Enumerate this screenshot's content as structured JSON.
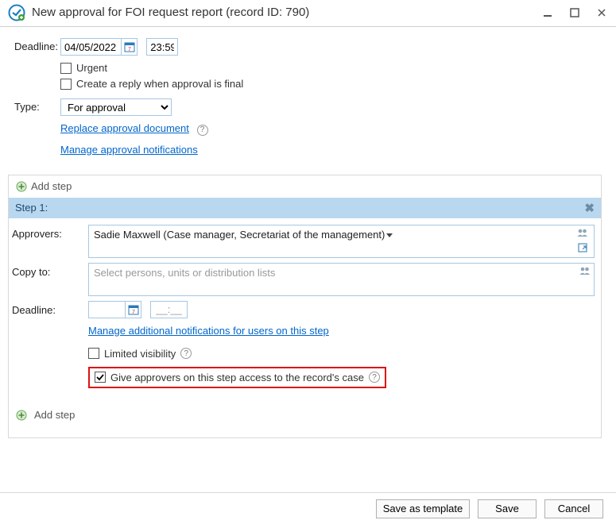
{
  "window": {
    "title": "New approval for FOI request report (record ID: 790)"
  },
  "form": {
    "deadline_label": "Deadline:",
    "deadline_date": "04/05/2022",
    "deadline_time": "23:59",
    "urgent_label": "Urgent",
    "create_reply_label": "Create a reply when approval is final",
    "type_label": "Type:",
    "type_value": "For approval",
    "replace_doc_link": "Replace approval document",
    "manage_notif_link": "Manage approval notifications"
  },
  "steps_section": {
    "add_step_label": "Add step",
    "step1": {
      "header": "Step 1:",
      "approvers_label": "Approvers:",
      "approver_value": "Sadie Maxwell (Case manager, Secretariat of the management)",
      "copyto_label": "Copy to:",
      "copyto_placeholder": "Select persons, units or distribution lists",
      "deadline_label": "Deadline:",
      "time_placeholder": "__:__",
      "manage_step_notif_link": "Manage additional notifications for users on this step",
      "limited_visibility_label": "Limited visibility",
      "give_access_label": "Give approvers on this step access to the record's case"
    }
  },
  "footer": {
    "save_template": "Save as template",
    "save": "Save",
    "cancel": "Cancel"
  }
}
